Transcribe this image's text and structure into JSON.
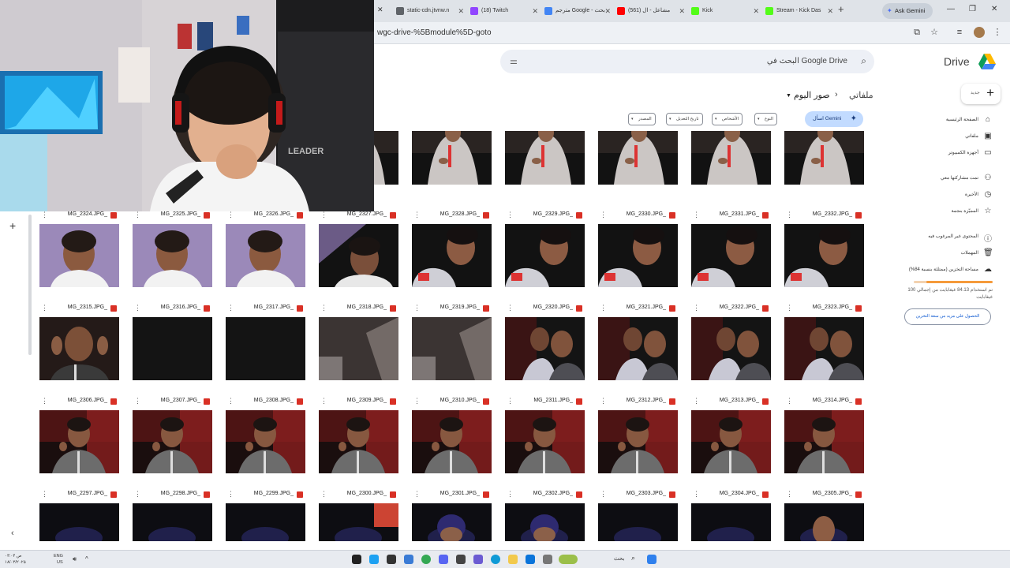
{
  "browser": {
    "tabs": [
      {
        "label": "static-cdn.jtvnw.n",
        "color": "#5f6368"
      },
      {
        "label": "(18) Twitch",
        "color": "#9146ff"
      },
      {
        "label": "مترجم Google - بحث",
        "color": "#4285f4"
      },
      {
        "label": "(561) مشاعل - ال",
        "color": "#ff0000"
      },
      {
        "label": "Kick",
        "color": "#53fc18"
      },
      {
        "label": "Stream - Kick Das",
        "color": "#53fc18"
      }
    ],
    "ask_gemini": "Ask Gemini",
    "url": "wgc-drive-%5Bmodule%5D-goto"
  },
  "drive": {
    "title": "Drive",
    "search_placeholder": "البحث في Google Drive",
    "new_label": "جديد",
    "breadcrumb": {
      "root": "ملفاتي",
      "separator": "›",
      "current": "صور اليوم"
    },
    "filters": [
      "النوع",
      "الأشخاص",
      "تاريخ التعديل",
      "المصدر"
    ],
    "gemini_chip": "اسأل Gemini",
    "sidebar": [
      {
        "label": "الصفحة الرئيسية",
        "icon": "home-icon"
      },
      {
        "label": "ملفاتي",
        "icon": "drive-icon"
      },
      {
        "label": "أجهزة الكمبيوتر",
        "icon": "computer-icon"
      },
      {
        "label": "تمت مشاركتها معي",
        "icon": "people-icon"
      },
      {
        "label": "الأخيرة",
        "icon": "clock-icon"
      },
      {
        "label": "المميّزة بنجمة",
        "icon": "star-icon"
      },
      {
        "label": "المحتوى غير المرغوب فيه",
        "icon": "spam-icon"
      },
      {
        "label": "المهملات",
        "icon": "trash-icon"
      },
      {
        "label": "مساحة التخزين (ممتلئة بنسبة 84%)",
        "icon": "cloud-icon"
      }
    ],
    "storage": {
      "used_fraction": 0.84,
      "text": "تم استخدام 84.13 غيغابايت من إجمالي 100 غيغابايت",
      "cta": "الحصول على مزيد من سعة التخزين"
    },
    "rows": [
      {
        "files": [
          "",
          "",
          "",
          "",
          "",
          ""
        ],
        "scene": "robe"
      },
      {
        "files": [
          "MG_2332.JPG_",
          "MG_2331.JPG_",
          "MG_2330.JPG_",
          "MG_2329.JPG_",
          "MG_2328.JPG_",
          "MG_2327.JPG_",
          "MG_2326.JPG_",
          "MG_2325.JPG_",
          "MG_2324.JPG_"
        ],
        "scene": "dark-profile"
      },
      {
        "files": [
          "MG_2323.JPG_",
          "MG_2322.JPG_",
          "MG_2321.JPG_",
          "MG_2320.JPG_",
          "MG_2319.JPG_",
          "MG_2318.JPG_",
          "MG_2317.JPG_",
          "MG_2316.JPG_",
          "MG_2315.JPG_"
        ],
        "scene": "group"
      },
      {
        "files": [
          "MG_2314.JPG_",
          "MG_2313.JPG_",
          "MG_2312.JPG_",
          "MG_2311.JPG_",
          "MG_2310.JPG_",
          "MG_2309.JPG_",
          "MG_2308.JPG_",
          "MG_2307.JPG_",
          "MG_2306.JPG_"
        ],
        "scene": "red-talk"
      },
      {
        "files": [
          "MG_2305.JPG_",
          "MG_2304.JPG_",
          "MG_2303.JPG_",
          "MG_2302.JPG_",
          "MG_2301.JPG_",
          "MG_2300.JPG_",
          "MG_2299.JPG_",
          "MG_2298.JPG_",
          "MG_2297.JPG_"
        ],
        "scene": "crowd"
      }
    ]
  },
  "taskbar": {
    "lang": "ENG",
    "region": "US",
    "time": "۰۳:۰۴ ص",
    "date": "۱۸/۰۳/۲۰۲۵",
    "search": "بحث"
  }
}
